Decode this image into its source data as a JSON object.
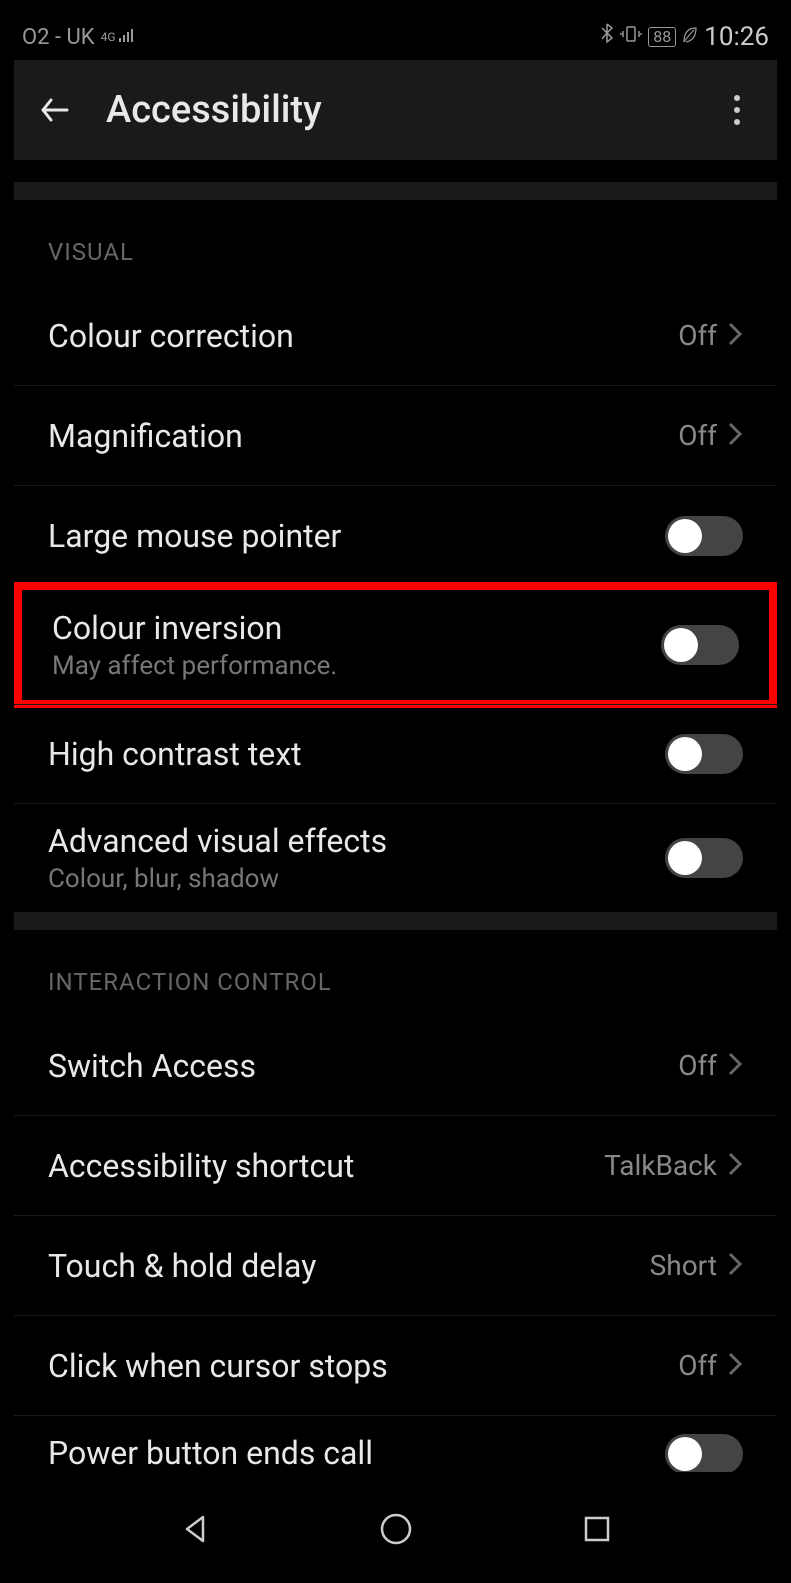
{
  "status": {
    "carrier": "O2 - UK",
    "network_badge": "4G",
    "battery": "88",
    "time": "10:26"
  },
  "header": {
    "title": "Accessibility"
  },
  "sections": [
    {
      "title": "VISUAL",
      "items": [
        {
          "title": "Colour correction",
          "value": "Off",
          "type": "link"
        },
        {
          "title": "Magnification",
          "value": "Off",
          "type": "link"
        },
        {
          "title": "Large mouse pointer",
          "type": "toggle",
          "on": false
        },
        {
          "title": "Colour inversion",
          "subtitle": "May affect performance.",
          "type": "toggle",
          "on": false,
          "highlighted": true
        },
        {
          "title": "High contrast text",
          "type": "toggle",
          "on": false
        },
        {
          "title": "Advanced visual effects",
          "subtitle": "Colour, blur, shadow",
          "type": "toggle",
          "on": false
        }
      ]
    },
    {
      "title": "INTERACTION CONTROL",
      "items": [
        {
          "title": "Switch Access",
          "value": "Off",
          "type": "link"
        },
        {
          "title": "Accessibility shortcut",
          "value": "TalkBack",
          "type": "link"
        },
        {
          "title": "Touch & hold delay",
          "value": "Short",
          "type": "link"
        },
        {
          "title": "Click when cursor stops",
          "value": "Off",
          "type": "link"
        },
        {
          "title": "Power button ends call",
          "type": "toggle",
          "on": false,
          "truncated": true
        }
      ]
    }
  ]
}
